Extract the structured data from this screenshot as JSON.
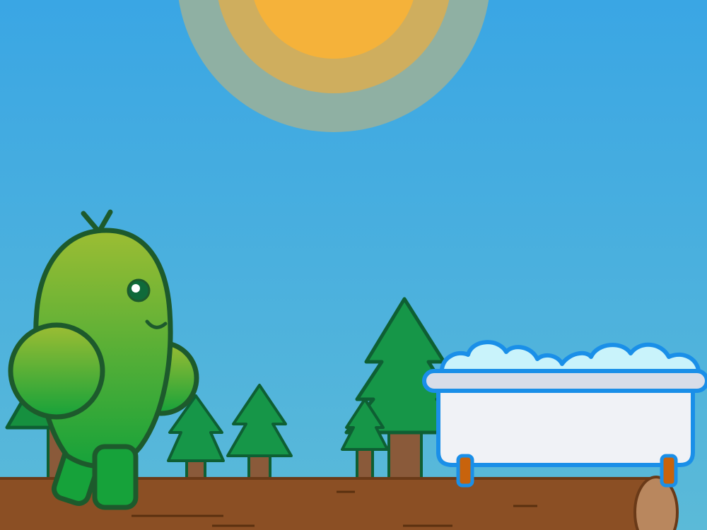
{
  "scene": {
    "colors": {
      "sky_top": "#3aa6e4",
      "sky_bottom": "#5bbad8",
      "sun_core": "#f5b23a",
      "sun_ring": "#cfae5e",
      "sun_halo": "#8fb0a3",
      "tree_dark": "#127a3e",
      "tree_light": "#169648",
      "tree_outline": "#0e5f33",
      "trunk": "#8a5a3a",
      "log": "#8b4f24",
      "log_end": "#b9875e",
      "log_end_outline": "#6a3a18",
      "creature_top": "#9cbd33",
      "creature_bottom": "#16a23a",
      "creature_outline": "#1d5a2c",
      "tub_body": "#f0f2f6",
      "tub_rim": "#d8dde8",
      "tub_outline": "#1a8fe8",
      "tub_feet": "#c8630c",
      "foam": "#c9f3fb"
    },
    "elements": {
      "sun": "sun",
      "creature": "green-creature",
      "bathtub": "bathtub",
      "log": "log"
    }
  }
}
